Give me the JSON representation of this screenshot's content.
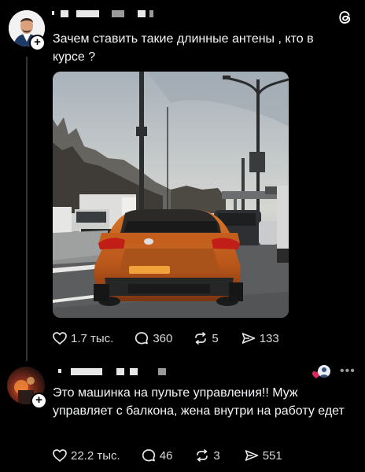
{
  "post1": {
    "text": "Зачем ставить такие длинные антены , кто в курсе ?",
    "image": {
      "caption": ""
    },
    "actions": {
      "likes": "1.7 тыс.",
      "replies": "360",
      "reposts": "5",
      "shares": "133"
    }
  },
  "post2": {
    "text": "Это машинка на пульте управления!! Муж управляет с балкона, жена внутри на работу едет",
    "actions": {
      "likes": "22.2 тыс.",
      "replies": "46",
      "reposts": "3",
      "shares": "551"
    }
  },
  "icons": {
    "app": "threads-logo-icon",
    "like": "heart-icon",
    "reply": "comment-icon",
    "repost": "repost-icon",
    "share": "share-icon",
    "follow": "plus-icon",
    "more": "more-icon"
  },
  "colors": {
    "background": "#000000",
    "text": "#f3f5f7",
    "muted": "#d9d9d9",
    "car_orange": "#c8641e",
    "heart_badge": "#e0245e"
  }
}
